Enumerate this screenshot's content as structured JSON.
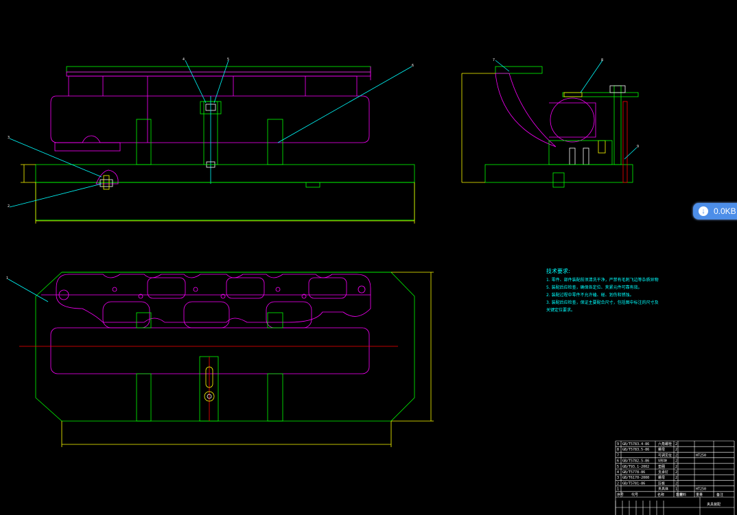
{
  "badge": {
    "text": "0.0KB",
    "icon": "download-arrow-icon"
  },
  "colors": {
    "outline": "#00ff00",
    "part": "#ff00ff",
    "dim": "#ffff00",
    "leader": "#00ffff",
    "center": "#ff0000",
    "white": "#ffffff"
  },
  "balloons": {
    "front": [
      "4",
      "5",
      "6",
      "3",
      "2"
    ],
    "side": [
      "7",
      "8",
      "9"
    ],
    "top": [
      "1"
    ]
  },
  "tech_notes": {
    "title": "技术要求:",
    "lines": [
      "1. 零件、部件装配前须清洗干净，严禁有毛刺飞边等杂质异物",
      "5. 装配后应检查，确保各定位、夹紧元件可靠有效。",
      "2. 装配过程中零件不允许磕、碰、划伤和锈蚀。",
      "3. 装配后应检查，保证主要配合尺寸，包括图中标注的尺寸及",
      "关键定位要求。"
    ]
  },
  "bom": {
    "rows": [
      [
        "9",
        "GB/T5783.4-86",
        "六角螺栓",
        "2",
        ""
      ],
      [
        "8",
        "GB/T5783.5-86",
        "螺母",
        "2",
        ""
      ],
      [
        "7",
        "",
        "可调定位",
        "2",
        "HT250"
      ],
      [
        "6",
        "GB/T5782.5-86",
        "V形块",
        "2",
        ""
      ],
      [
        "5",
        "GB/T93.1-2002",
        "垫圈",
        "2",
        ""
      ],
      [
        "4",
        "GB/T5778-86",
        "支承钉",
        "2",
        ""
      ],
      [
        "3",
        "GB/T6170-2000",
        "螺母",
        "2",
        ""
      ],
      [
        "2",
        "GB/T5781-86",
        "压板",
        "2",
        ""
      ],
      [
        "1",
        "",
        "夹具体",
        "1",
        "HT250"
      ]
    ],
    "header": [
      "序号",
      "代号",
      "名称",
      "数量",
      "材料",
      "重量",
      "备注"
    ],
    "title": "夹具装配"
  }
}
